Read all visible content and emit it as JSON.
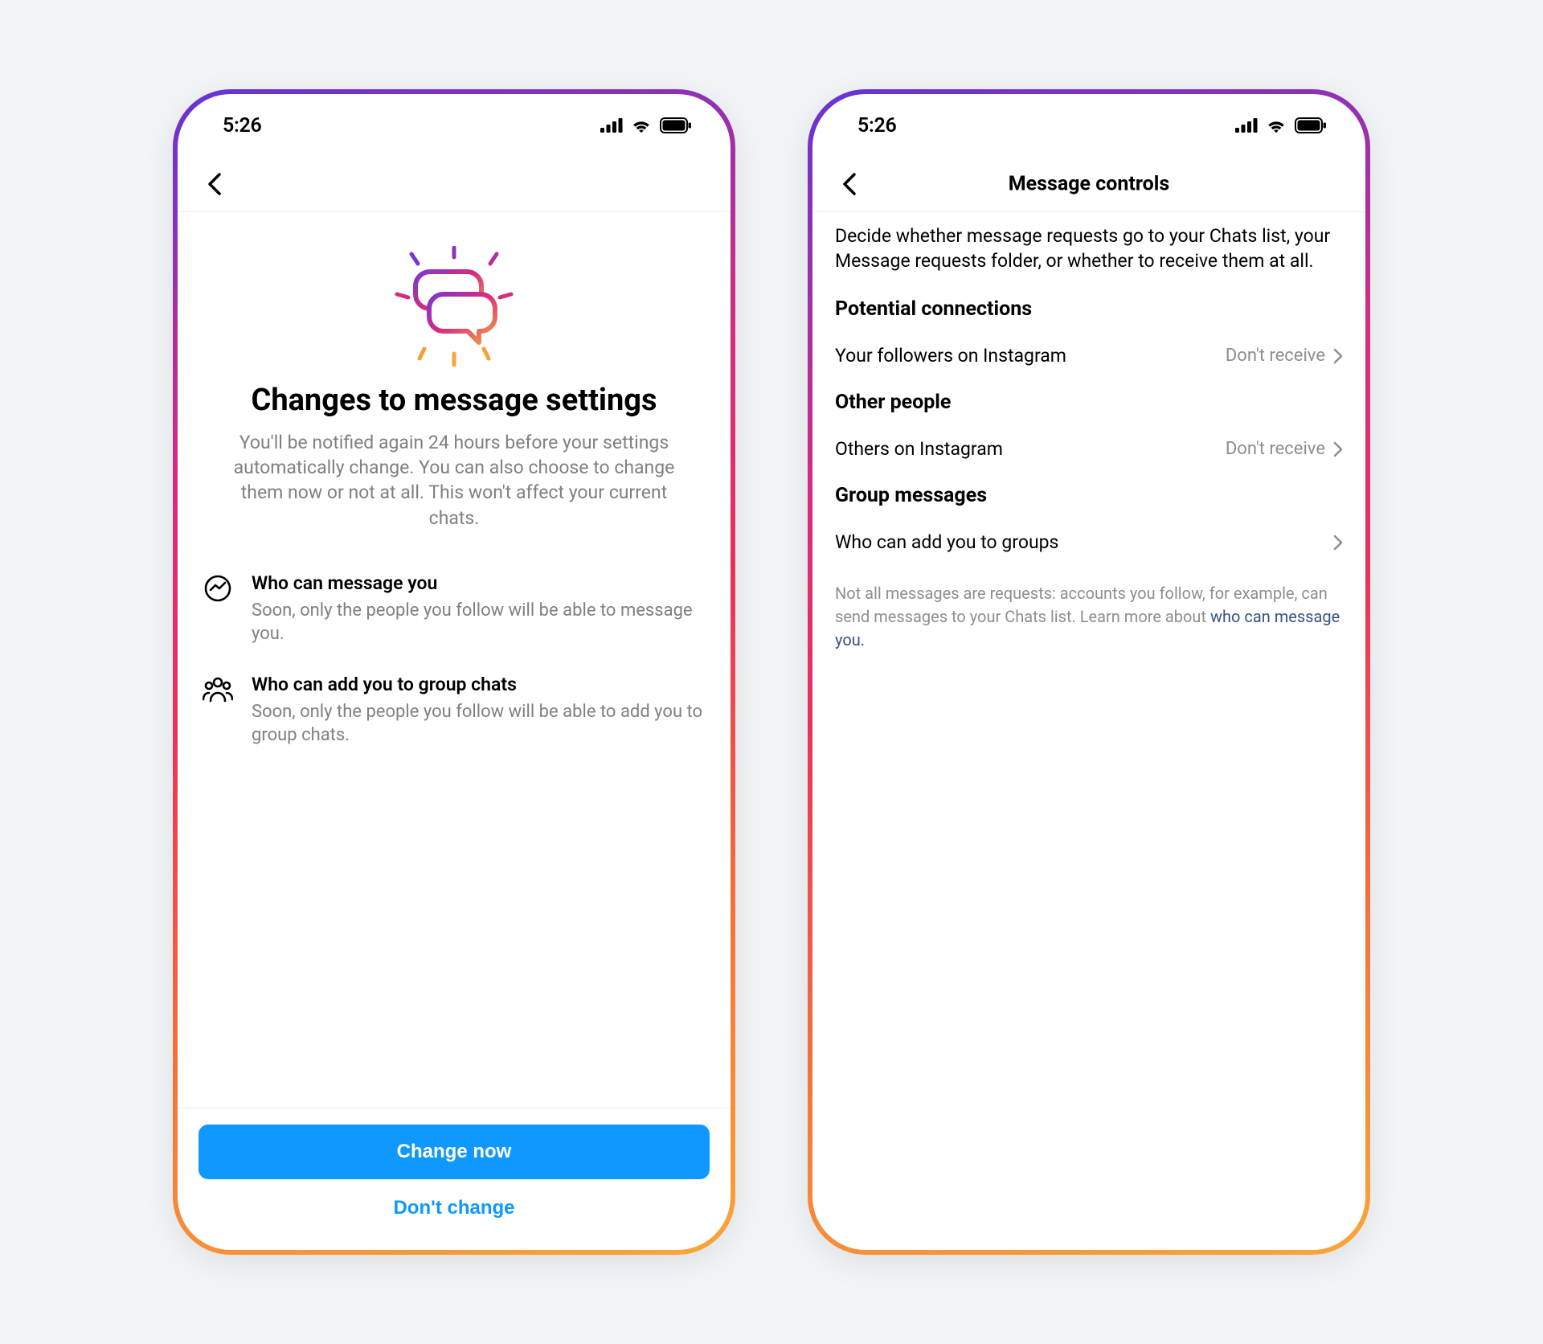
{
  "status_time": "5:26",
  "screen1": {
    "hero_title": "Changes to message settings",
    "hero_desc": "You'll be notified again 24 hours before your settings automatically change. You can also choose to change them now or not at all. This won't affect your current chats.",
    "features": [
      {
        "title": "Who can message you",
        "body": "Soon, only the people you follow will be able to message you."
      },
      {
        "title": "Who can add you to group chats",
        "body": "Soon, only the people you follow will be able to add you to group chats."
      }
    ],
    "primary_label": "Change now",
    "secondary_label": "Don't change"
  },
  "screen2": {
    "nav_title": "Message controls",
    "intro": "Decide whether message requests go to your Chats list, your Message requests folder, or whether to receive them at all.",
    "sections": [
      {
        "heading": "Potential connections",
        "row_title": "Your followers on Instagram",
        "row_value": "Don't receive"
      },
      {
        "heading": "Other people",
        "row_title": "Others on Instagram",
        "row_value": "Don't receive"
      },
      {
        "heading": "Group messages",
        "row_title": "Who can add you to groups",
        "row_value": ""
      }
    ],
    "footer_text": "Not all messages are requests: accounts you follow, for example, can send messages to your Chats list. Learn more about ",
    "footer_link": "who can message you."
  }
}
